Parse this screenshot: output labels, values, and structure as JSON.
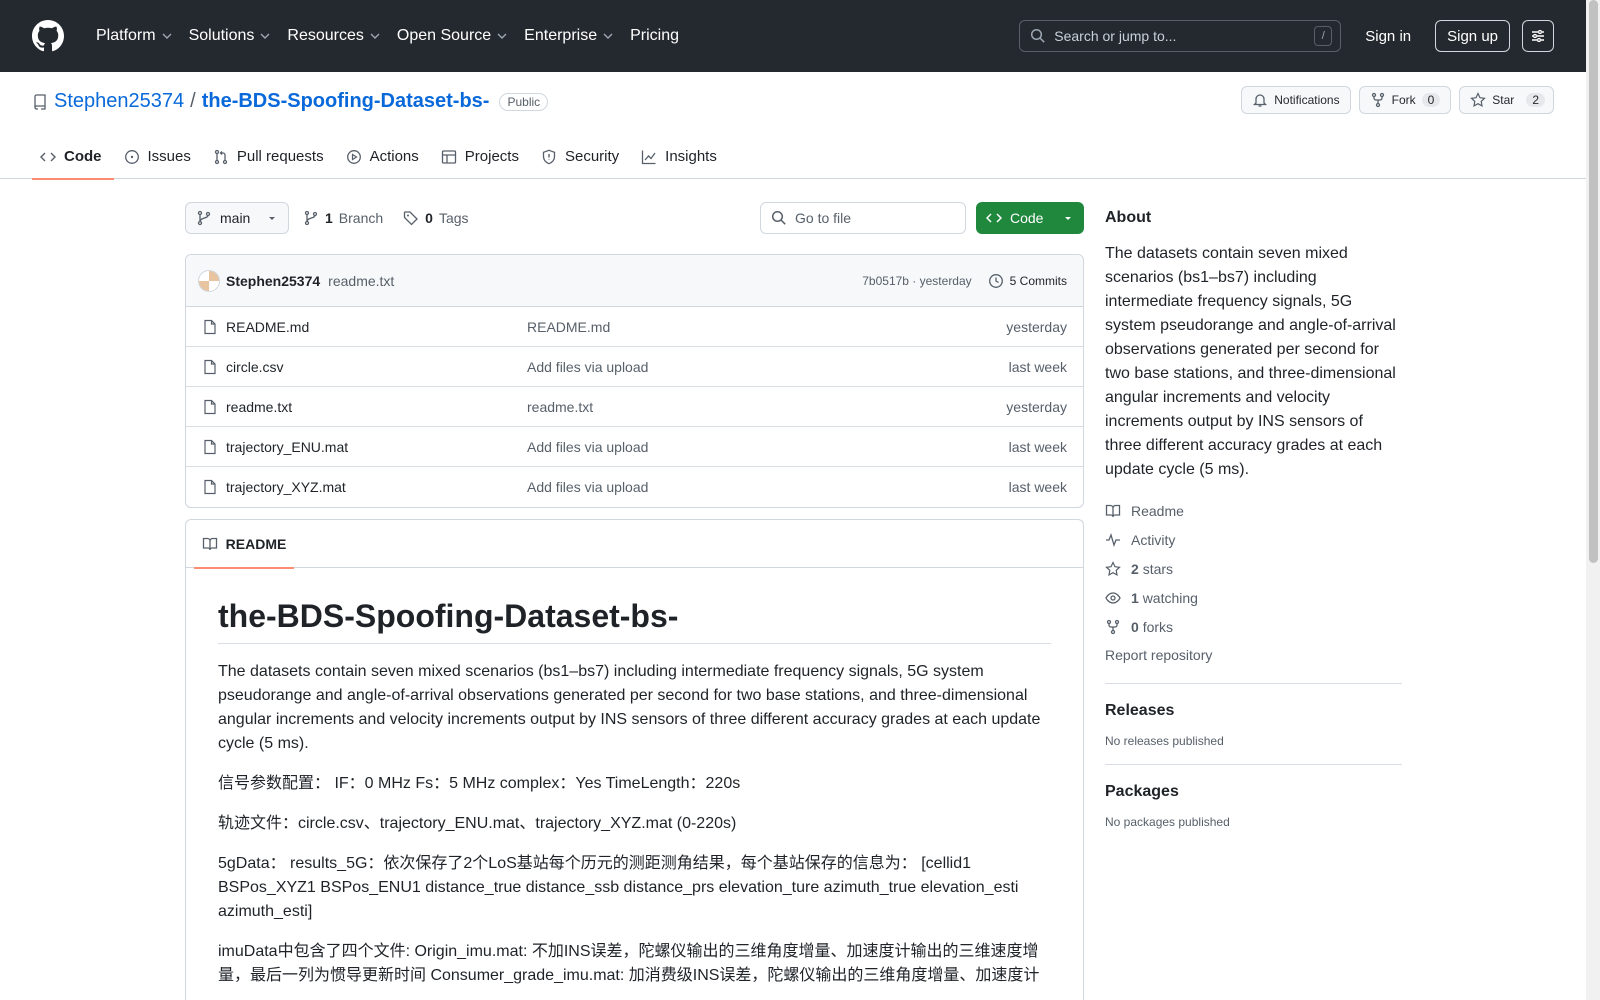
{
  "header": {
    "nav": [
      "Platform",
      "Solutions",
      "Resources",
      "Open Source",
      "Enterprise",
      "Pricing"
    ],
    "search_placeholder": "Search or jump to...",
    "search_key": "/",
    "signin": "Sign in",
    "signup": "Sign up"
  },
  "repo": {
    "owner": "Stephen25374",
    "sep": "/",
    "name": "the-BDS-Spoofing-Dataset-bs-",
    "visibility": "Public",
    "notifications": "Notifications",
    "fork_label": "Fork",
    "fork_count": "0",
    "star_label": "Star",
    "star_count": "2",
    "tabs": [
      "Code",
      "Issues",
      "Pull requests",
      "Actions",
      "Projects",
      "Security",
      "Insights"
    ]
  },
  "toolbar": {
    "branch": "main",
    "branch_count": "1",
    "branch_label": "Branch",
    "tag_count": "0",
    "tag_label": "Tags",
    "goto_placeholder": "Go to file",
    "code_label": "Code"
  },
  "commit": {
    "author": "Stephen25374",
    "message": "readme.txt",
    "hash_time": "7b0517b · yesterday",
    "commits": "5 Commits"
  },
  "files": [
    {
      "name": "README.md",
      "commit": "README.md",
      "date": "yesterday"
    },
    {
      "name": "circle.csv",
      "commit": "Add files via upload",
      "date": "last week"
    },
    {
      "name": "readme.txt",
      "commit": "readme.txt",
      "date": "yesterday"
    },
    {
      "name": "trajectory_ENU.mat",
      "commit": "Add files via upload",
      "date": "last week"
    },
    {
      "name": "trajectory_XYZ.mat",
      "commit": "Add files via upload",
      "date": "last week"
    }
  ],
  "readme": {
    "tab": "README",
    "title": "the-BDS-Spoofing-Dataset-bs-",
    "paragraphs": [
      "The datasets contain seven mixed scenarios (bs1–bs7) including intermediate frequency signals, 5G system pseudorange and angle-of-arrival observations generated per second for two base stations, and three-dimensional angular increments and velocity increments output by INS sensors of three different accuracy grades at each update cycle (5 ms).",
      "信号参数配置： IF：0 MHz Fs：5 MHz complex：Yes TimeLength：220s",
      "轨迹文件：circle.csv、trajectory_ENU.mat、trajectory_XYZ.mat (0-220s)",
      "5gData： results_5G：依次保存了2个LoS基站每个历元的测距测角结果，每个基站保存的信息为： [cellid1 BSPos_XYZ1 BSPos_ENU1 distance_true distance_ssb distance_prs elevation_ture azimuth_true elevation_esti azimuth_esti]",
      "imuData中包含了四个文件: Origin_imu.mat: 不加INS误差，陀螺仪输出的三维角度增量、加速度计输出的三维速度增量，最后一列为惯导更新时间 Consumer_grade_imu.mat: 加消费级INS误差，陀螺仪输出的三维角度增量、加速度计"
    ]
  },
  "about": {
    "heading": "About",
    "description": "The datasets contain seven mixed scenarios (bs1–bs7) including intermediate frequency signals, 5G system pseudorange and angle-of-arrival observations generated per second for two base stations, and three-dimensional angular increments and velocity increments output by INS sensors of three different accuracy grades at each update cycle (5 ms).",
    "readme": "Readme",
    "activity": "Activity",
    "stars_count": "2",
    "stars_label": "stars",
    "watching_count": "1",
    "watching_label": "watching",
    "forks_count": "0",
    "forks_label": "forks",
    "report": "Report repository"
  },
  "releases": {
    "heading": "Releases",
    "sub": "No releases published"
  },
  "packages": {
    "heading": "Packages",
    "sub": "No packages published"
  },
  "colors": {
    "header_bg": "#24292f",
    "link": "#0969da",
    "primary_button": "#1f883d",
    "tab_underline": "#fd8c73"
  }
}
